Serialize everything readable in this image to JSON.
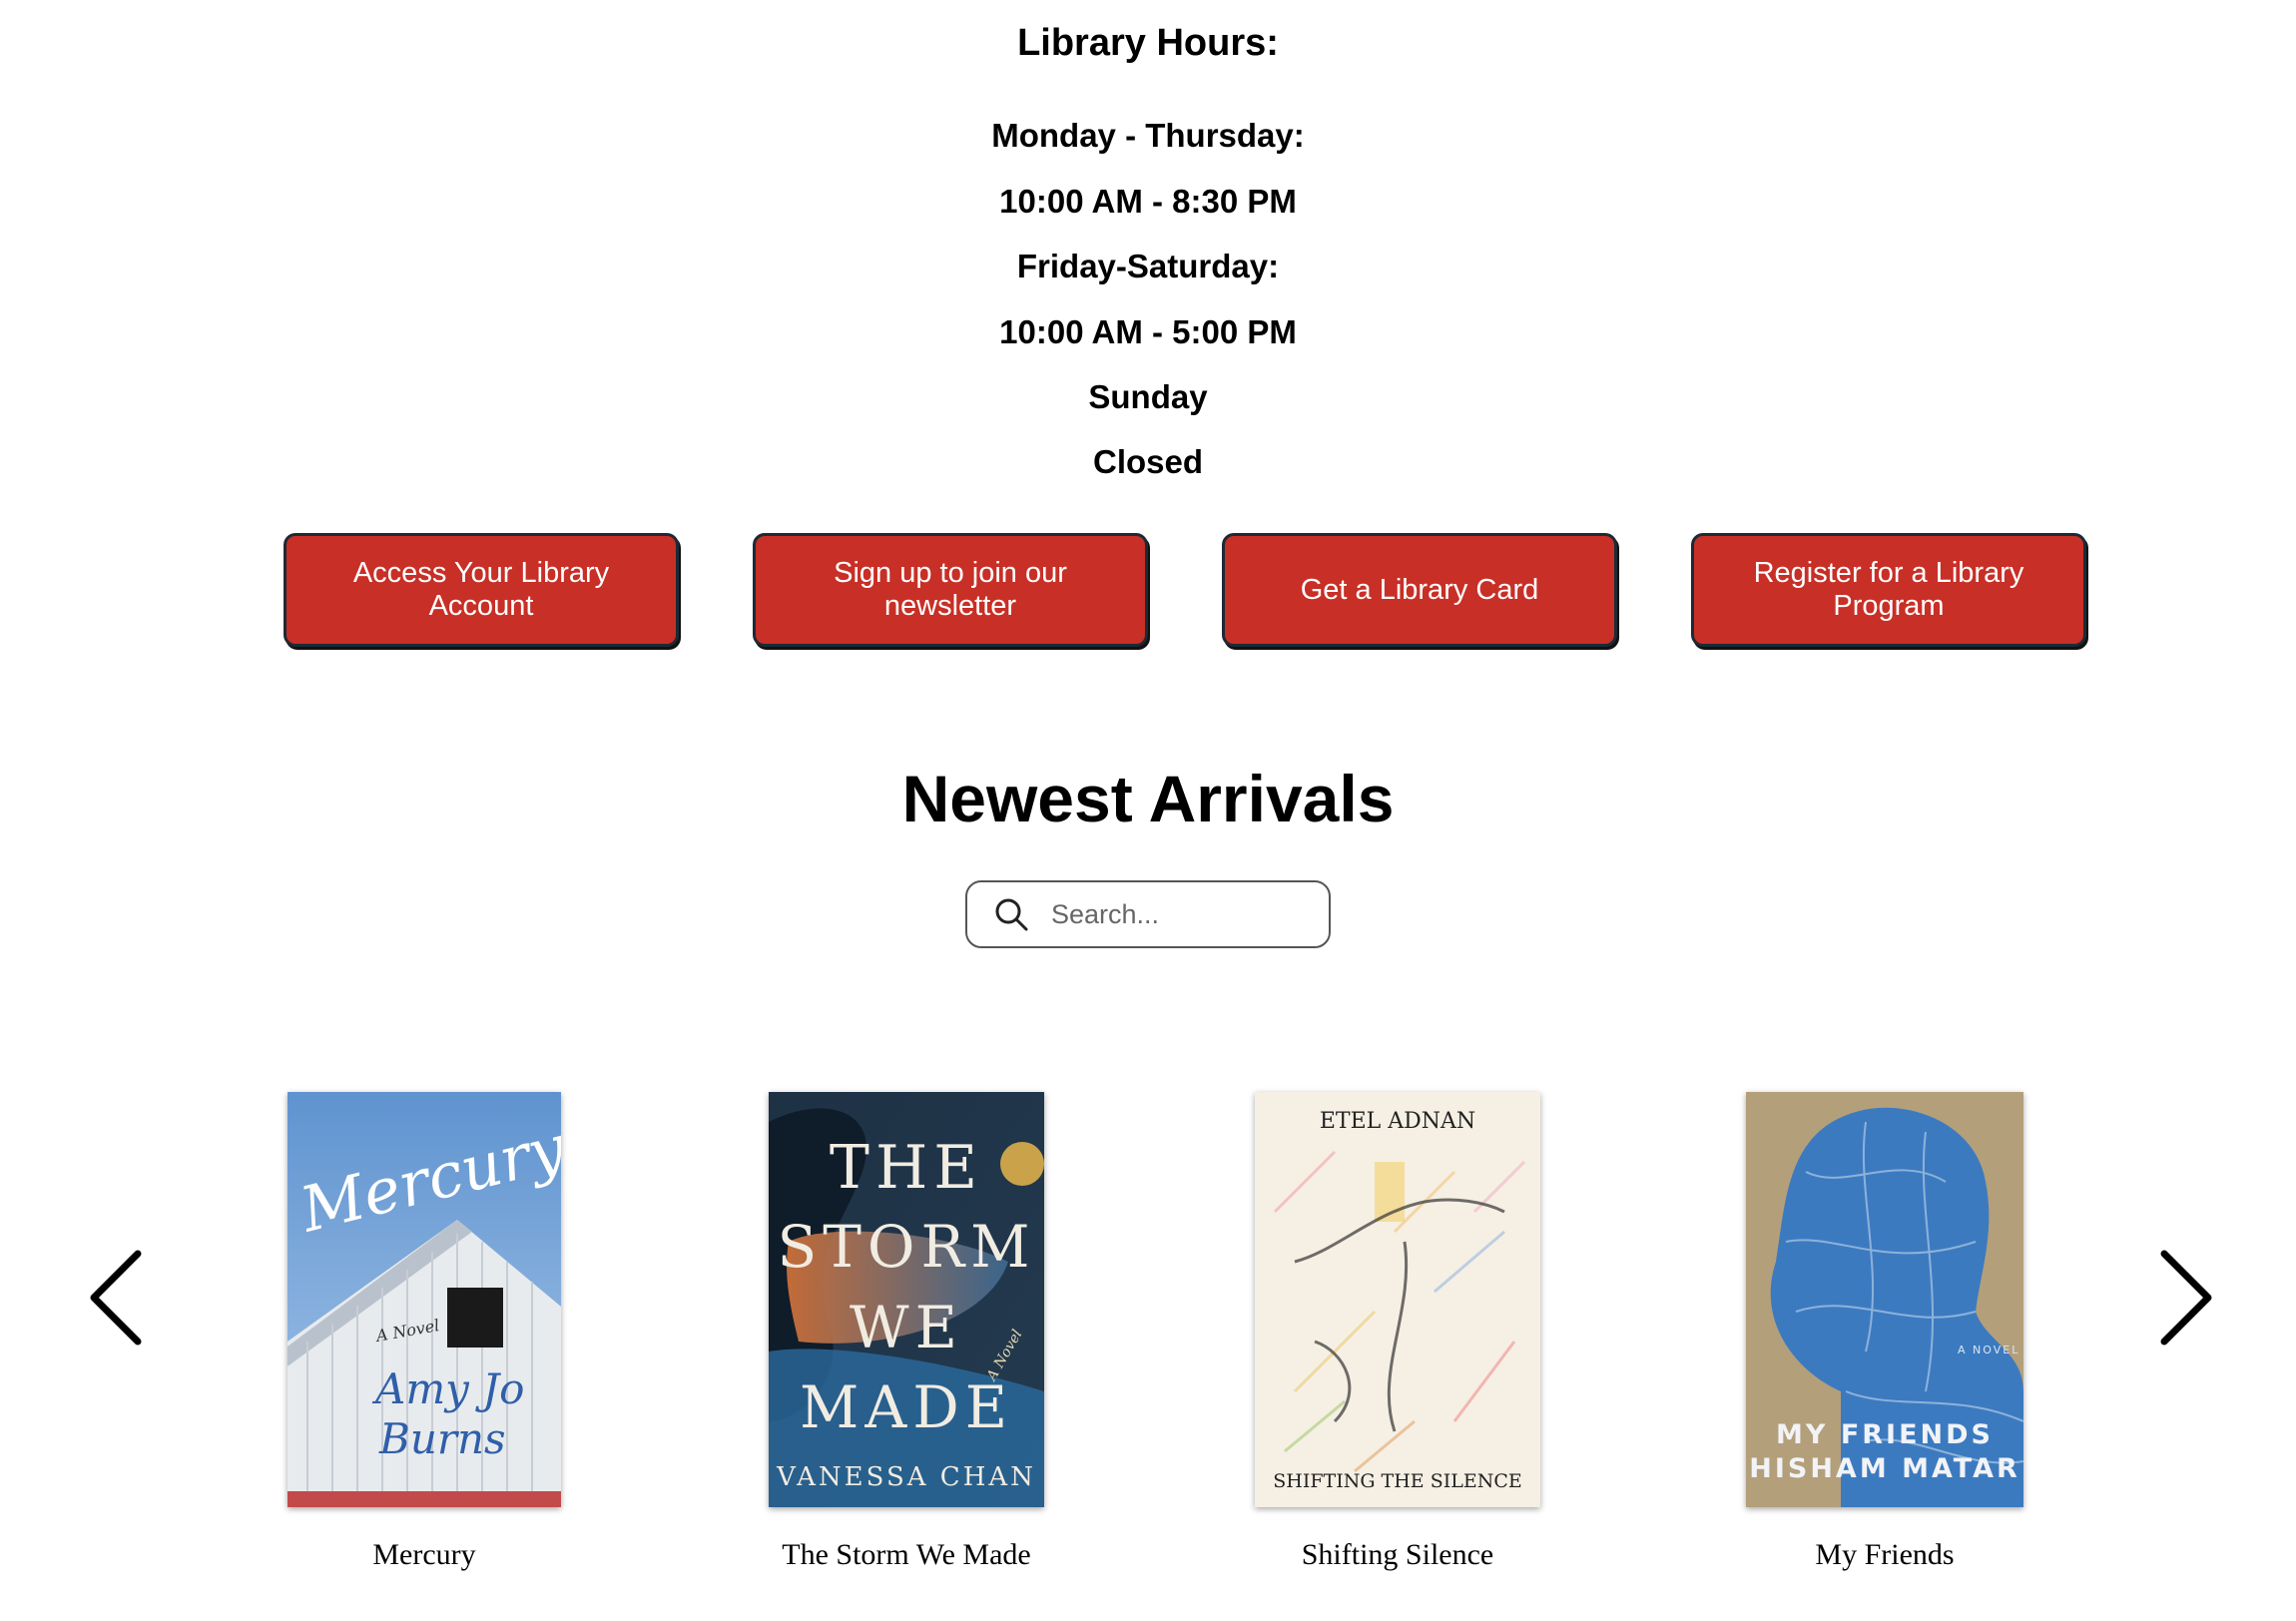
{
  "hours": {
    "title": "Library Hours:",
    "lines": [
      "Monday - Thursday:",
      "10:00 AM - 8:30 PM",
      "Friday-Saturday:",
      "10:00 AM - 5:00 PM",
      "Sunday",
      "Closed"
    ]
  },
  "buttons": [
    {
      "label": "Access Your Library Account"
    },
    {
      "label": "Sign up to join our newsletter"
    },
    {
      "label": "Get a Library Card"
    },
    {
      "label": "Register for a Library Program"
    }
  ],
  "arrivals": {
    "title": "Newest Arrivals",
    "search_placeholder": "Search..."
  },
  "books": [
    {
      "title": "Mercury",
      "cover_text": [
        "Mercury",
        "A Novel",
        "Amy Jo",
        "Burns"
      ]
    },
    {
      "title": "The Storm We Made",
      "cover_text": [
        "THE",
        "STORM",
        "WE",
        "MADE",
        "A Novel",
        "VANESSA CHAN"
      ]
    },
    {
      "title": "Shifting Silence",
      "cover_text": [
        "ETEL ADNAN",
        "SHIFTING THE SILENCE"
      ]
    },
    {
      "title": "My Friends",
      "cover_text": [
        "A NOVEL",
        "MY FRIENDS",
        "HISHAM MATAR"
      ]
    }
  ],
  "colors": {
    "button_bg": "#c82f26",
    "button_border": "#1c2a36"
  },
  "icons": {
    "search": "search-icon",
    "prev": "chevron-left-icon",
    "next": "chevron-right-icon"
  }
}
